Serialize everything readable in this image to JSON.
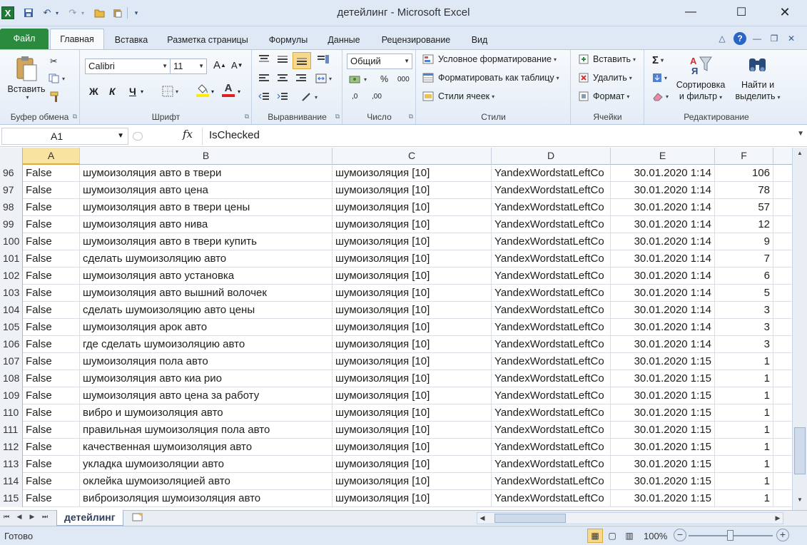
{
  "window": {
    "title": "детейлинг - Microsoft Excel",
    "app_icon": "X"
  },
  "ribbon_tabs": [
    "Файл",
    "Главная",
    "Вставка",
    "Разметка страницы",
    "Формулы",
    "Данные",
    "Рецензирование",
    "Вид"
  ],
  "active_tab": "Главная",
  "ribbon": {
    "clipboard": {
      "label": "Буфер обмена",
      "paste": "Вставить"
    },
    "font": {
      "label": "Шрифт",
      "name": "Calibri",
      "size": "11",
      "bold": "Ж",
      "italic": "К",
      "underline": "Ч",
      "grow": "A",
      "shrink": "A",
      "color_letter": "A",
      "fill_color": "#ffeb00",
      "font_color": "#e02020"
    },
    "alignment": {
      "label": "Выравнивание"
    },
    "number": {
      "label": "Число",
      "format": "Общий",
      "percent": "%",
      "thousands": "000",
      "inc_dec": ",0",
      "dec_dec": ",00"
    },
    "styles": {
      "label": "Стили",
      "conditional": "Условное форматирование",
      "as_table": "Форматировать как таблицу",
      "cell_styles": "Стили ячеек"
    },
    "cells": {
      "label": "Ячейки",
      "insert": "Вставить",
      "delete": "Удалить",
      "format": "Формат"
    },
    "editing": {
      "label": "Редактирование",
      "sort_line1": "Сортировка",
      "sort_line2": "и фильтр",
      "find_line1": "Найти и",
      "find_line2": "выделить",
      "sigma": "Σ"
    }
  },
  "formula_bar": {
    "name_box": "A1",
    "fx": "fx",
    "value": "IsChecked"
  },
  "columns": [
    "A",
    "B",
    "C",
    "D",
    "E",
    "F"
  ],
  "selected_column": "A",
  "rows": [
    {
      "n": "96",
      "a": "False",
      "b": "шумоизоляция авто в твери",
      "c": "шумоизоляция [10]",
      "d": "YandexWordstatLeftCo",
      "e": "30.01.2020 1:14",
      "f": "106"
    },
    {
      "n": "97",
      "a": "False",
      "b": "шумоизоляция авто цена",
      "c": "шумоизоляция [10]",
      "d": "YandexWordstatLeftCo",
      "e": "30.01.2020 1:14",
      "f": "78"
    },
    {
      "n": "98",
      "a": "False",
      "b": "шумоизоляция авто в твери цены",
      "c": "шумоизоляция [10]",
      "d": "YandexWordstatLeftCo",
      "e": "30.01.2020 1:14",
      "f": "57"
    },
    {
      "n": "99",
      "a": "False",
      "b": "шумоизоляция авто нива",
      "c": "шумоизоляция [10]",
      "d": "YandexWordstatLeftCo",
      "e": "30.01.2020 1:14",
      "f": "12"
    },
    {
      "n": "100",
      "a": "False",
      "b": "шумоизоляция авто в твери купить",
      "c": "шумоизоляция [10]",
      "d": "YandexWordstatLeftCo",
      "e": "30.01.2020 1:14",
      "f": "9"
    },
    {
      "n": "101",
      "a": "False",
      "b": "сделать шумоизоляцию авто",
      "c": "шумоизоляция [10]",
      "d": "YandexWordstatLeftCo",
      "e": "30.01.2020 1:14",
      "f": "7"
    },
    {
      "n": "102",
      "a": "False",
      "b": "шумоизоляция авто установка",
      "c": "шумоизоляция [10]",
      "d": "YandexWordstatLeftCo",
      "e": "30.01.2020 1:14",
      "f": "6"
    },
    {
      "n": "103",
      "a": "False",
      "b": "шумоизоляция авто вышний волочек",
      "c": "шумоизоляция [10]",
      "d": "YandexWordstatLeftCo",
      "e": "30.01.2020 1:14",
      "f": "5"
    },
    {
      "n": "104",
      "a": "False",
      "b": "сделать шумоизоляцию авто цены",
      "c": "шумоизоляция [10]",
      "d": "YandexWordstatLeftCo",
      "e": "30.01.2020 1:14",
      "f": "3"
    },
    {
      "n": "105",
      "a": "False",
      "b": "шумоизоляция арок авто",
      "c": "шумоизоляция [10]",
      "d": "YandexWordstatLeftCo",
      "e": "30.01.2020 1:14",
      "f": "3"
    },
    {
      "n": "106",
      "a": "False",
      "b": "где сделать шумоизоляцию авто",
      "c": "шумоизоляция [10]",
      "d": "YandexWordstatLeftCo",
      "e": "30.01.2020 1:14",
      "f": "3"
    },
    {
      "n": "107",
      "a": "False",
      "b": "шумоизоляция пола авто",
      "c": "шумоизоляция [10]",
      "d": "YandexWordstatLeftCo",
      "e": "30.01.2020 1:15",
      "f": "1"
    },
    {
      "n": "108",
      "a": "False",
      "b": "шумоизоляция авто киа рио",
      "c": "шумоизоляция [10]",
      "d": "YandexWordstatLeftCo",
      "e": "30.01.2020 1:15",
      "f": "1"
    },
    {
      "n": "109",
      "a": "False",
      "b": "шумоизоляция авто цена за работу",
      "c": "шумоизоляция [10]",
      "d": "YandexWordstatLeftCo",
      "e": "30.01.2020 1:15",
      "f": "1"
    },
    {
      "n": "110",
      "a": "False",
      "b": "вибро и шумоизоляция авто",
      "c": "шумоизоляция [10]",
      "d": "YandexWordstatLeftCo",
      "e": "30.01.2020 1:15",
      "f": "1"
    },
    {
      "n": "111",
      "a": "False",
      "b": "правильная шумоизоляция пола авто",
      "c": "шумоизоляция [10]",
      "d": "YandexWordstatLeftCo",
      "e": "30.01.2020 1:15",
      "f": "1"
    },
    {
      "n": "112",
      "a": "False",
      "b": "качественная шумоизоляция авто",
      "c": "шумоизоляция [10]",
      "d": "YandexWordstatLeftCo",
      "e": "30.01.2020 1:15",
      "f": "1"
    },
    {
      "n": "113",
      "a": "False",
      "b": "укладка шумоизоляции авто",
      "c": "шумоизоляция [10]",
      "d": "YandexWordstatLeftCo",
      "e": "30.01.2020 1:15",
      "f": "1"
    },
    {
      "n": "114",
      "a": "False",
      "b": "оклейка шумоизоляцией авто",
      "c": "шумоизоляция [10]",
      "d": "YandexWordstatLeftCo",
      "e": "30.01.2020 1:15",
      "f": "1"
    },
    {
      "n": "115",
      "a": "False",
      "b": "виброизоляция шумоизоляция авто",
      "c": "шумоизоляция [10]",
      "d": "YandexWordstatLeftCo",
      "e": "30.01.2020 1:15",
      "f": "1"
    }
  ],
  "sheet": {
    "name": "детейлинг"
  },
  "status": {
    "text": "Готово",
    "zoom": "100%",
    "zoom_fraction": 0.5
  },
  "colors": {
    "file_tab": "#2a8a3e",
    "selection": "#f8e3a0",
    "ribbon_bg": "#dfe9f5"
  }
}
